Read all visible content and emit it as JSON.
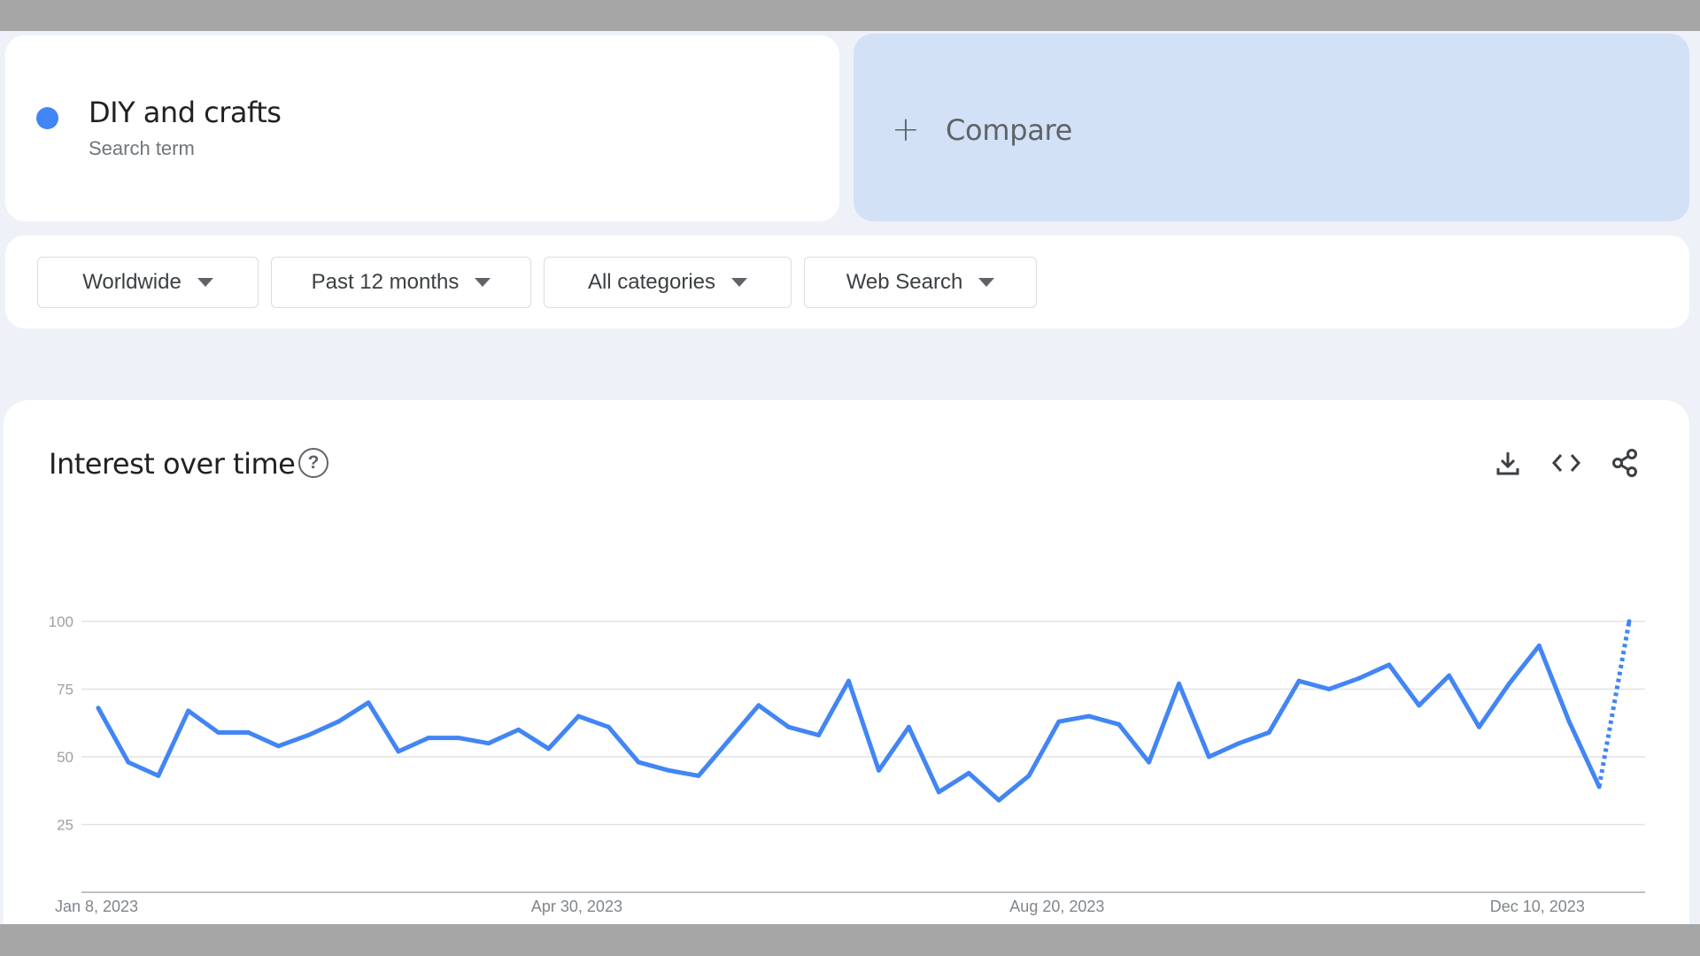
{
  "search_term": {
    "name": "DIY and crafts",
    "subtitle": "Search term",
    "color": "#4285f4"
  },
  "compare": {
    "label": "Compare",
    "icon": "plus-icon"
  },
  "filters": [
    {
      "label": "Worldwide"
    },
    {
      "label": "Past 12 months"
    },
    {
      "label": "All categories"
    },
    {
      "label": "Web Search"
    }
  ],
  "interest_card": {
    "title": "Interest over time",
    "help_icon": "help-circle-icon",
    "actions": [
      "download-icon",
      "embed-code-icon",
      "share-icon"
    ]
  },
  "chart_data": {
    "type": "line",
    "title": "",
    "xlabel": "",
    "ylabel": "",
    "ylim": [
      0,
      100
    ],
    "yticks": [
      25,
      50,
      75,
      100
    ],
    "xtick_labels": [
      "Jan 8, 2023",
      "Apr 30, 2023",
      "Aug 20, 2023",
      "Dec 10, 2023"
    ],
    "xtick_indices": [
      0,
      16,
      32,
      48
    ],
    "grid": true,
    "legend": "none",
    "series": [
      {
        "color": "#4285f4",
        "values": [
          68,
          48,
          43,
          67,
          59,
          59,
          54,
          58,
          63,
          70,
          52,
          57,
          57,
          55,
          60,
          53,
          65,
          61,
          48,
          45,
          43,
          56,
          69,
          61,
          58,
          78,
          45,
          61,
          37,
          44,
          34,
          43,
          63,
          65,
          62,
          48,
          77,
          50,
          55,
          59,
          78,
          75,
          79,
          84,
          69,
          80,
          61,
          77,
          91,
          63,
          39,
          100
        ],
        "partial_from_index": 50
      }
    ]
  }
}
